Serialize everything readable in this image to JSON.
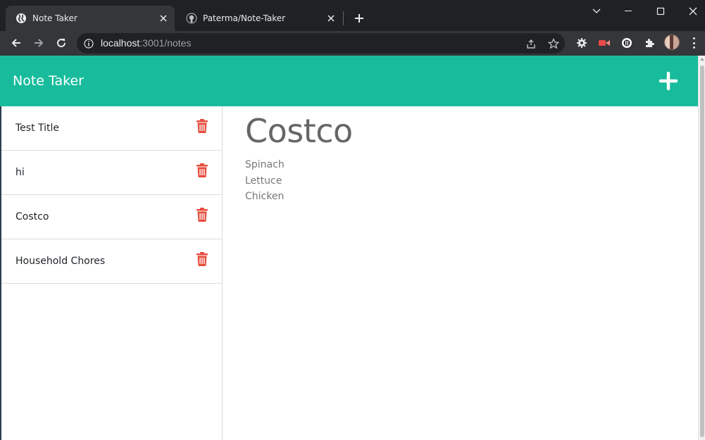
{
  "browser": {
    "tabs": [
      {
        "title": "Note Taker",
        "active": true,
        "icon": "globe-icon"
      },
      {
        "title": "Paterma/Note-Taker",
        "active": false,
        "icon": "github-icon"
      }
    ],
    "address": {
      "host": "localhost",
      "rest": ":3001/notes"
    },
    "colors": {
      "frame": "#202124",
      "toolbar": "#35363a",
      "text": "#e8eaed"
    }
  },
  "app": {
    "brand": "Note Taker",
    "add_icon": "plus-icon",
    "colors": {
      "navbar": "#18bc9c",
      "trash": "#e74c3c",
      "title": "#666666"
    }
  },
  "notes": [
    {
      "title": "Test Title"
    },
    {
      "title": "hi"
    },
    {
      "title": "Costco"
    },
    {
      "title": "Household Chores"
    }
  ],
  "active_note": {
    "title": "Costco",
    "lines": [
      "Spinach",
      "Lettuce",
      "Chicken"
    ]
  }
}
